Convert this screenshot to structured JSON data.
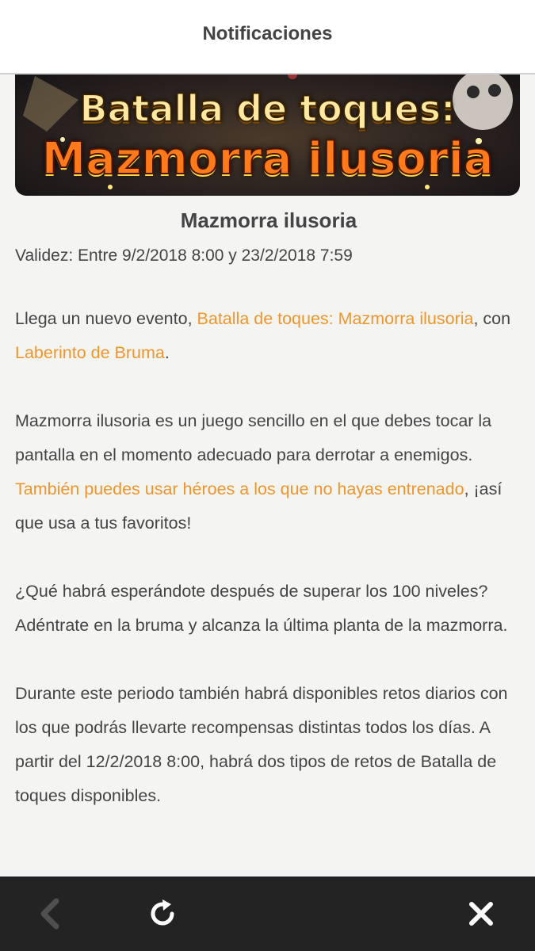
{
  "header": {
    "title": "Notificaciones"
  },
  "banner": {
    "line1": "Batalla de toques:",
    "line2": "Mazmorra ilusoria"
  },
  "article": {
    "title": "Mazmorra ilusoria",
    "validity": "Validez: Entre 9/2/2018 8:00 y 23/2/2018 7:59",
    "p1": {
      "t1": "Llega un nuevo evento, ",
      "link1": "Batalla de toques: Mazmorra ilusoria",
      "t2": ", con ",
      "link2": "Laberinto de Bruma",
      "t3": "."
    },
    "p2": {
      "t1": "Mazmorra ilusoria es un juego sencillo en el que debes tocar la pantalla en el momento adecuado para derrotar a enemigos. ",
      "link1": "También puedes usar héroes a los que no hayas entrenado",
      "t2": ", ¡así que usa a tus favoritos!"
    },
    "p3": "¿Qué habrá esperándote después de superar los 100 niveles? Adéntrate en la bruma y alcanza la última planta de la mazmorra.",
    "p4": "Durante este periodo también habrá disponibles retos diarios con los que podrás llevarte recompensas distintas todos los días. A partir del 12/2/2018 8:00, habrá dos tipos de retos de Batalla de toques disponibles."
  },
  "toolbar": {
    "back_icon": "chevron-left-icon",
    "refresh_icon": "refresh-icon",
    "close_icon": "close-icon",
    "colors": {
      "bar": "#232323",
      "icon": "#ffffff",
      "disabled_icon": "#555555"
    }
  },
  "colors": {
    "link": "#f0952a",
    "text": "#444444",
    "background": "#f4f5f3"
  }
}
